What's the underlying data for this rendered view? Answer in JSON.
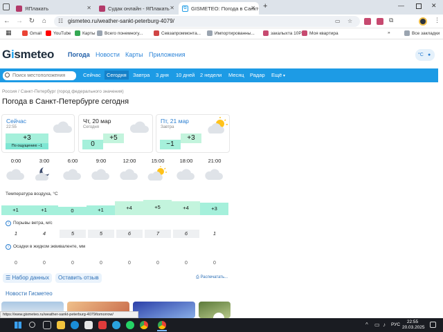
{
  "browser": {
    "tabs": [
      {
        "title": "ЯПлакать",
        "active": false
      },
      {
        "title": "Судак онлайн - ЯПлакать",
        "active": false
      },
      {
        "title": "GISMETEO: Погода в Санкт-Петер",
        "active": true
      }
    ],
    "new_tab": "+",
    "url": "gismeteo.ru/weather-sankt-peterburg-4079/",
    "bookmarks": [
      "Gmail",
      "YouTube",
      "Карты",
      "Всего понемногу...",
      "Севзапроммонта...",
      "Импортированны...",
      "закалыхта 10Р",
      "Моя квартира"
    ],
    "bookmarks_more": "»",
    "all_bookmarks": "Все закладки",
    "status_url": "https://www.gismeteo.ru/weather-sankt-peterburg-4079/tomorrow/"
  },
  "site": {
    "logo": "Gismeteo",
    "logo_pre": "G",
    "logo_i": "i",
    "logo_post": "smeteo",
    "nav": [
      "Погода",
      "Новости",
      "Карты",
      "Приложения"
    ],
    "unit_toggle": "°C",
    "search_placeholder": "Поиск местоположения",
    "time_tabs": [
      "Сейчас",
      "Сегодня",
      "Завтра",
      "3 дня",
      "10 дней",
      "2 недели",
      "Месяц",
      "Радар",
      "Ещё"
    ],
    "breadcrumbs": "Россия / Санкт-Петербург (город федерального значения)",
    "heading": "Погода в Санкт-Петербурге сегодня"
  },
  "cards": {
    "now": {
      "title": "Сейчас",
      "time": "22:55",
      "temp": "+3",
      "feels": "По ощущению −1"
    },
    "today": {
      "title": "Чт, 20 мар",
      "sub": "Сегодня",
      "tmin": "0",
      "tmax": "+5"
    },
    "tomorrow": {
      "title": "Пт, 21 мар",
      "sub": "Завтра",
      "tmin": "−1",
      "tmax": "+3"
    }
  },
  "hourly": {
    "hours": [
      "0:00",
      "3:00",
      "6:00",
      "9:00",
      "12:00",
      "15:00",
      "18:00",
      "21:00"
    ],
    "icons": [
      "cloud-icon",
      "moon-cloud-icon",
      "cloud-icon",
      "cloud-icon",
      "cloud-icon",
      "sun-cloud-icon",
      "cloud-icon",
      "cloud-icon"
    ],
    "temp_label": "Температура воздуха, °C",
    "temps": [
      "+1",
      "+1",
      "0",
      "+1",
      "+4",
      "+5",
      "+4",
      "+3"
    ],
    "temp_values": [
      1,
      1,
      0,
      1,
      4,
      5,
      4,
      3
    ],
    "wind_label": "Порывы ветра, м/с",
    "wind": [
      "1",
      "4",
      "5",
      "5",
      "6",
      "7",
      "6",
      "1"
    ],
    "precip_label": "Осадки в жидком эквиваленте, мм",
    "precip": [
      "0",
      "0",
      "0",
      "0",
      "0",
      "0",
      "0",
      "0"
    ]
  },
  "actions": {
    "data_set": "Набор данных",
    "feedback": "Оставить отзыв",
    "print": "Распечатать..."
  },
  "news": {
    "title": "Новости Гисметео"
  },
  "taskbar": {
    "lang": "РУС",
    "time": "22:55",
    "date": "20.03.2025"
  },
  "colors": {
    "accent": "#1d9be5",
    "link": "#2c84d8",
    "temp_block": "#a5f0db"
  }
}
